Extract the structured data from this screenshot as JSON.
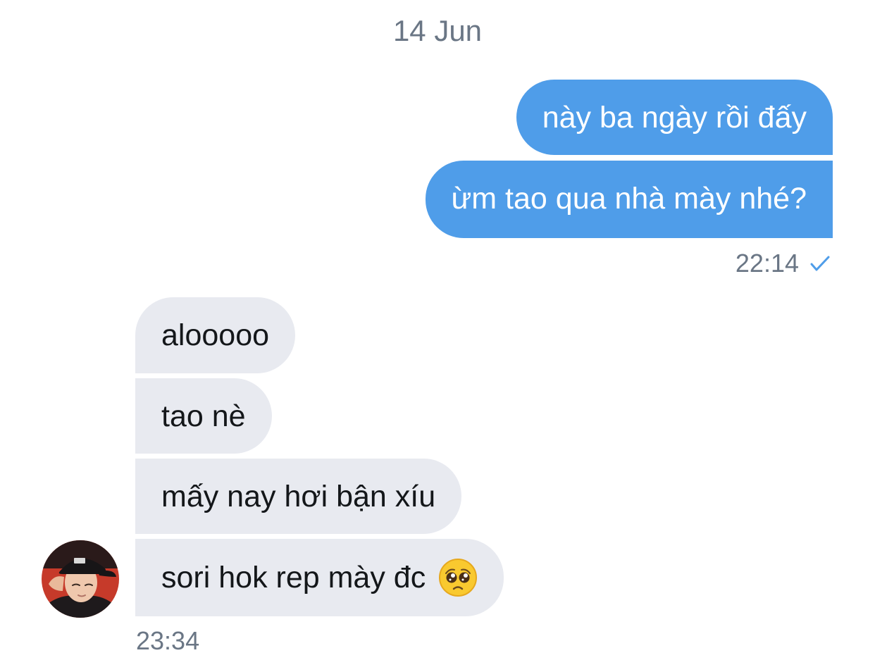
{
  "chat": {
    "date_header": "14 Jun",
    "outgoing_group": {
      "messages": [
        {
          "text": "này ba ngày rồi đấy"
        },
        {
          "text": "ừm tao qua nhà mày nhé?"
        }
      ],
      "time": "22:14",
      "status_icon": "checkmark-icon",
      "status_color": "#4f9de9"
    },
    "incoming_group": {
      "messages": [
        {
          "text": "alooooo"
        },
        {
          "text": "tao nè"
        },
        {
          "text": "mấy nay hơi bận xíu"
        },
        {
          "text": "sori hok rep mày đc",
          "emoji": "pleading-face-emoji"
        }
      ],
      "time": "23:34",
      "avatar": "contact-avatar"
    }
  },
  "colors": {
    "outgoing_bubble": "#4f9de9",
    "incoming_bubble": "#e8eaf0",
    "meta_text": "#6a7685"
  }
}
